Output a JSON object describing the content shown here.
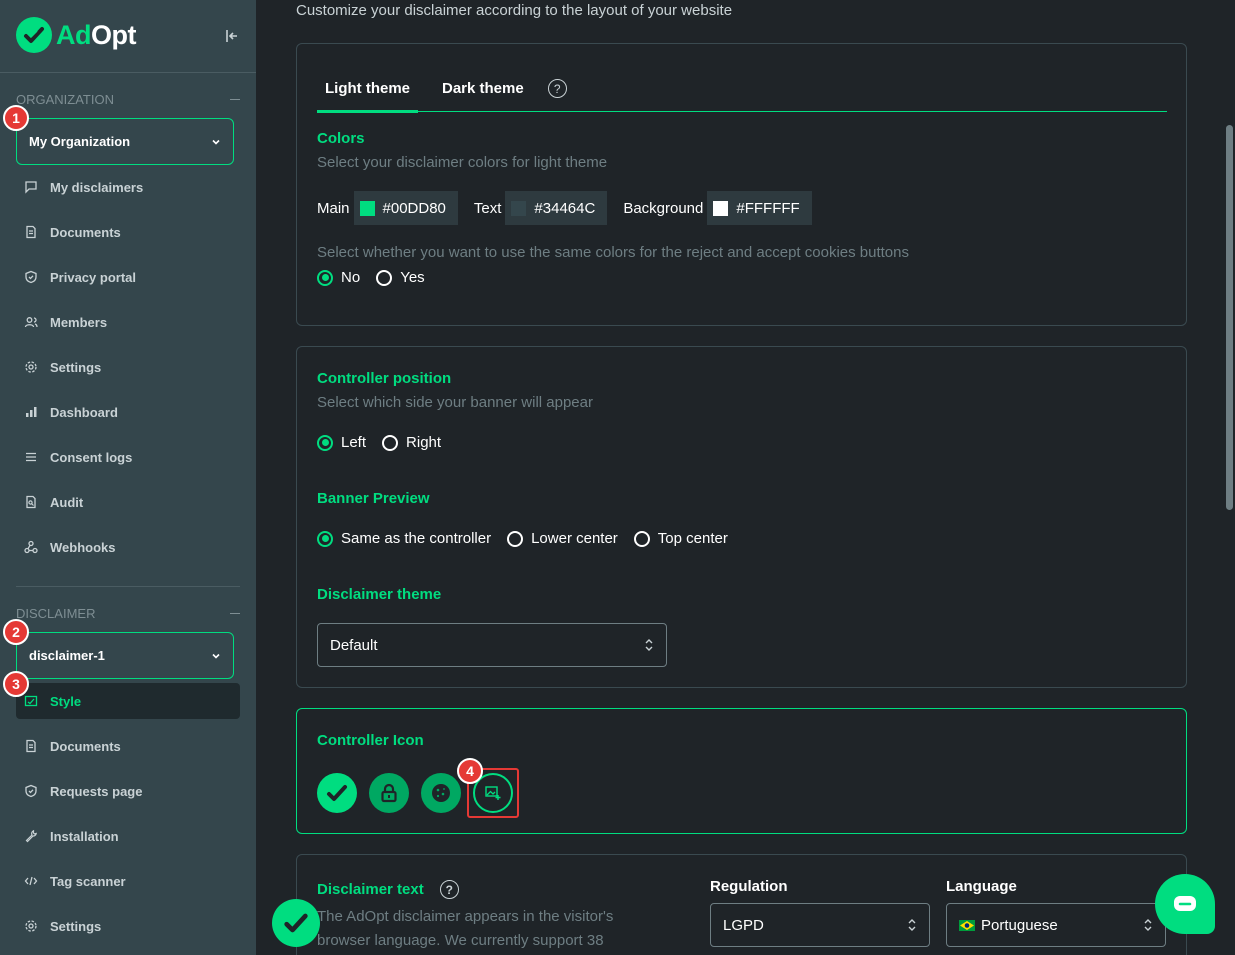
{
  "brand": {
    "name_a": "Ad",
    "name_b": "Opt",
    "accent": "#00DD80"
  },
  "sidebar": {
    "org_section": "ORGANIZATION",
    "org_select": "My Organization",
    "org_items": [
      {
        "label": "My disclaimers",
        "icon": "chat-icon"
      },
      {
        "label": "Documents",
        "icon": "document-icon"
      },
      {
        "label": "Privacy portal",
        "icon": "shield-icon"
      },
      {
        "label": "Members",
        "icon": "members-icon"
      },
      {
        "label": "Settings",
        "icon": "gear-icon"
      },
      {
        "label": "Dashboard",
        "icon": "bar-chart-icon"
      },
      {
        "label": "Consent logs",
        "icon": "list-icon"
      },
      {
        "label": "Audit",
        "icon": "audit-icon"
      },
      {
        "label": "Webhooks",
        "icon": "webhook-icon"
      }
    ],
    "disclaimer_section": "DISCLAIMER",
    "disclaimer_select": "disclaimer-1",
    "disclaimer_items": [
      {
        "label": "Style",
        "icon": "style-icon",
        "active": true
      },
      {
        "label": "Documents",
        "icon": "document-icon"
      },
      {
        "label": "Requests page",
        "icon": "shield-icon"
      },
      {
        "label": "Installation",
        "icon": "wrench-icon"
      },
      {
        "label": "Tag scanner",
        "icon": "code-icon"
      },
      {
        "label": "Settings",
        "icon": "gear-icon"
      }
    ]
  },
  "badges": [
    "1",
    "2",
    "3",
    "4"
  ],
  "main": {
    "subtitle": "Customize your disclaimer according to the layout of your website",
    "tabs": [
      "Light theme",
      "Dark theme"
    ],
    "help_glyph": "?",
    "colors": {
      "title": "Colors",
      "description": "Select your disclaimer colors for light theme",
      "main_label": "Main",
      "main_value": "#00DD80",
      "text_label": "Text",
      "text_value": "#34464C",
      "bg_label": "Background",
      "bg_value": "#FFFFFF",
      "same_colors_question": "Select whether you want to use the same colors for the reject and accept cookies buttons",
      "option_no": "No",
      "option_yes": "Yes"
    },
    "controller_position": {
      "title": "Controller position",
      "description": "Select which side your banner will appear",
      "option_left": "Left",
      "option_right": "Right"
    },
    "banner_preview": {
      "title": "Banner Preview",
      "option_same": "Same as the controller",
      "option_lower": "Lower center",
      "option_top": "Top center"
    },
    "disclaimer_theme": {
      "title": "Disclaimer theme",
      "value": "Default"
    },
    "controller_icon": {
      "title": "Controller Icon"
    },
    "disclaimer_text": {
      "title": "Disclaimer text",
      "body": "The AdOpt disclaimer appears in the visitor's browser language. We currently support 38",
      "regulation_label": "Regulation",
      "regulation_value": "LGPD",
      "language_label": "Language",
      "language_value": "Portuguese"
    }
  }
}
